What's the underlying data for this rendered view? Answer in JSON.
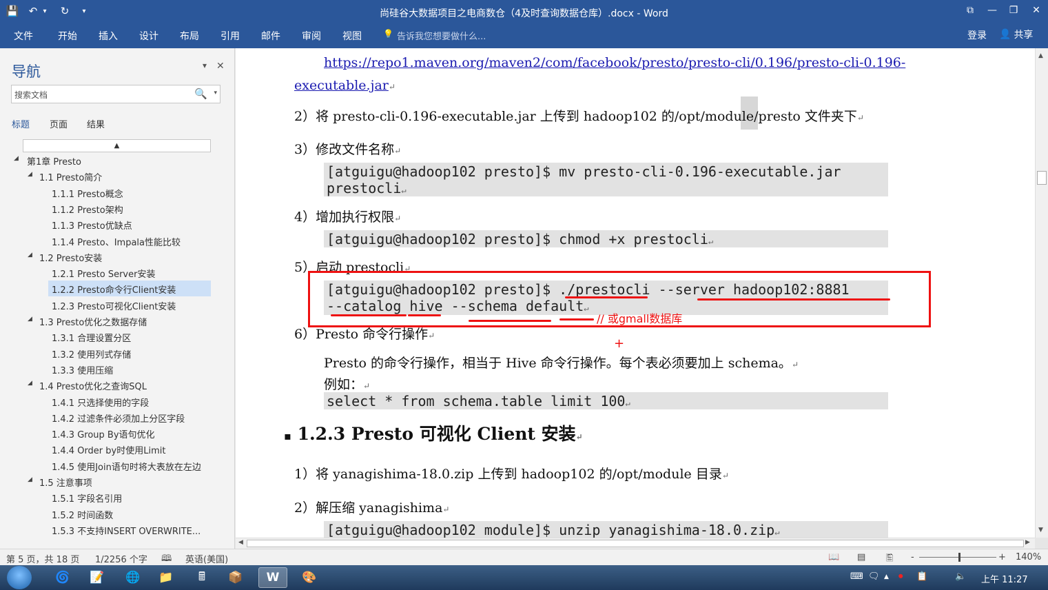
{
  "window": {
    "title": "尚硅谷大数据项目之电商数仓（4及时查询数据仓库）.docx - Word",
    "quick_access": {
      "save_icon": "💾",
      "undo_icon": "↶",
      "undo_drop": "▾",
      "redo_icon": "↻",
      "customize_icon": "▾"
    },
    "controls": {
      "ribbon_display": "⧉",
      "minimize": "—",
      "maximize": "❐",
      "close": "✕"
    }
  },
  "ribbon": {
    "tabs": [
      "文件",
      "开始",
      "插入",
      "设计",
      "布局",
      "引用",
      "邮件",
      "审阅",
      "视图"
    ],
    "tell_me": "告诉我您想要做什么...",
    "tell_me_icon": "💡",
    "login": "登录",
    "share": "共享",
    "share_icon": "👤"
  },
  "navigation": {
    "title": "导航",
    "options_icon": "▾",
    "close_icon": "✕",
    "search_placeholder": "搜索文档",
    "search_icon": "🔍",
    "search_dropdown": "▾",
    "tabs": [
      "标题",
      "页面",
      "结果"
    ],
    "collapse_icon": "▲",
    "tree": [
      {
        "label": "第1章 Presto",
        "level": 0,
        "expanded": true
      },
      {
        "label": "1.1 Presto简介",
        "level": 1,
        "expanded": true
      },
      {
        "label": "1.1.1 Presto概念",
        "level": 2
      },
      {
        "label": "1.1.2 Presto架构",
        "level": 2
      },
      {
        "label": "1.1.3 Presto优缺点",
        "level": 2
      },
      {
        "label": "1.1.4 Presto、Impala性能比较",
        "level": 2
      },
      {
        "label": "1.2 Presto安装",
        "level": 1,
        "expanded": true
      },
      {
        "label": "1.2.1 Presto Server安装",
        "level": 2
      },
      {
        "label": "1.2.2 Presto命令行Client安装",
        "level": 2,
        "selected": true
      },
      {
        "label": "1.2.3 Presto可视化Client安装",
        "level": 2
      },
      {
        "label": "1.3 Presto优化之数据存储",
        "level": 1,
        "expanded": true
      },
      {
        "label": "1.3.1 合理设置分区",
        "level": 2
      },
      {
        "label": "1.3.2 使用列式存储",
        "level": 2
      },
      {
        "label": "1.3.3 使用压缩",
        "level": 2
      },
      {
        "label": "1.4 Presto优化之查询SQL",
        "level": 1,
        "expanded": true
      },
      {
        "label": "1.4.1 只选择使用的字段",
        "level": 2
      },
      {
        "label": "1.4.2 过滤条件必须加上分区字段",
        "level": 2
      },
      {
        "label": "1.4.3 Group By语句优化",
        "level": 2
      },
      {
        "label": "1.4.4 Order by时使用Limit",
        "level": 2
      },
      {
        "label": "1.4.5 使用Join语句时将大表放在左边",
        "level": 2
      },
      {
        "label": "1.5 注意事项",
        "level": 1,
        "expanded": true
      },
      {
        "label": "1.5.1 字段名引用",
        "level": 2
      },
      {
        "label": "1.5.2 时间函数",
        "level": 2
      },
      {
        "label": "1.5.3 不支持INSERT OVERWRITE...",
        "level": 2
      }
    ]
  },
  "document": {
    "link_line1": "https://repo1.maven.org/maven2/com/facebook/presto/presto-cli/0.196/presto-cli-0.196-",
    "link_line2": "executable.jar",
    "para_mark": "↵",
    "step2": "2）将 presto-cli-0.196-executable.jar 上传到 hadoop102 的/opt/module/presto 文件夹下",
    "step3": "3）修改文件名称",
    "code_mv_1": "[atguigu@hadoop102 presto]$ mv presto-cli-0.196-executable.jar",
    "code_mv_2": "prestocli",
    "step4": "4）增加执行权限",
    "code_chmod": "[atguigu@hadoop102 presto]$ chmod +x prestocli",
    "step5": "5）启动 prestocli",
    "code_start_1": "[atguigu@hadoop102 presto]$ ./prestocli --server hadoop102:8881",
    "code_start_2": "--catalog hive --schema default",
    "annotation": "// 或gmall数据库",
    "step6": "6）Presto 命令行操作",
    "desc": "Presto 的命令行操作，相当于 Hive 命令行操作。每个表必须要加上 schema。",
    "example": "例如：",
    "code_select": "select * from schema.table limit 100",
    "heading": "1.2.3 Presto 可视化 Client 安装",
    "heading_bullet": "▪",
    "s1": "1）将 yanagishima-18.0.zip 上传到 hadoop102 的/opt/module 目录",
    "s2": "2）解压缩 yanagishima",
    "code_unzip": "[atguigu@hadoop102 module]$ unzip yanagishima-18.0.zip"
  },
  "statusbar": {
    "page": "第 5 页，共 18 页",
    "words": "1/2256 个字",
    "proof_icon": "🕮",
    "language": "英语(美国)",
    "read_mode_icon": "📖",
    "print_layout_icon": "▤",
    "web_layout_icon": "🖺",
    "zoom_out": "-",
    "zoom_in": "+",
    "zoom": "140%",
    "zoom_level": 0.52
  },
  "taskbar": {
    "apps": [
      "🌀",
      "📝",
      "🌐",
      "📁",
      "🖩",
      "📦",
      "W",
      "🎨"
    ],
    "tray_icons": [
      "⌨",
      "🗨",
      "▲",
      "⏺",
      "📋",
      "🔈"
    ],
    "clock": "上午 11:27"
  }
}
